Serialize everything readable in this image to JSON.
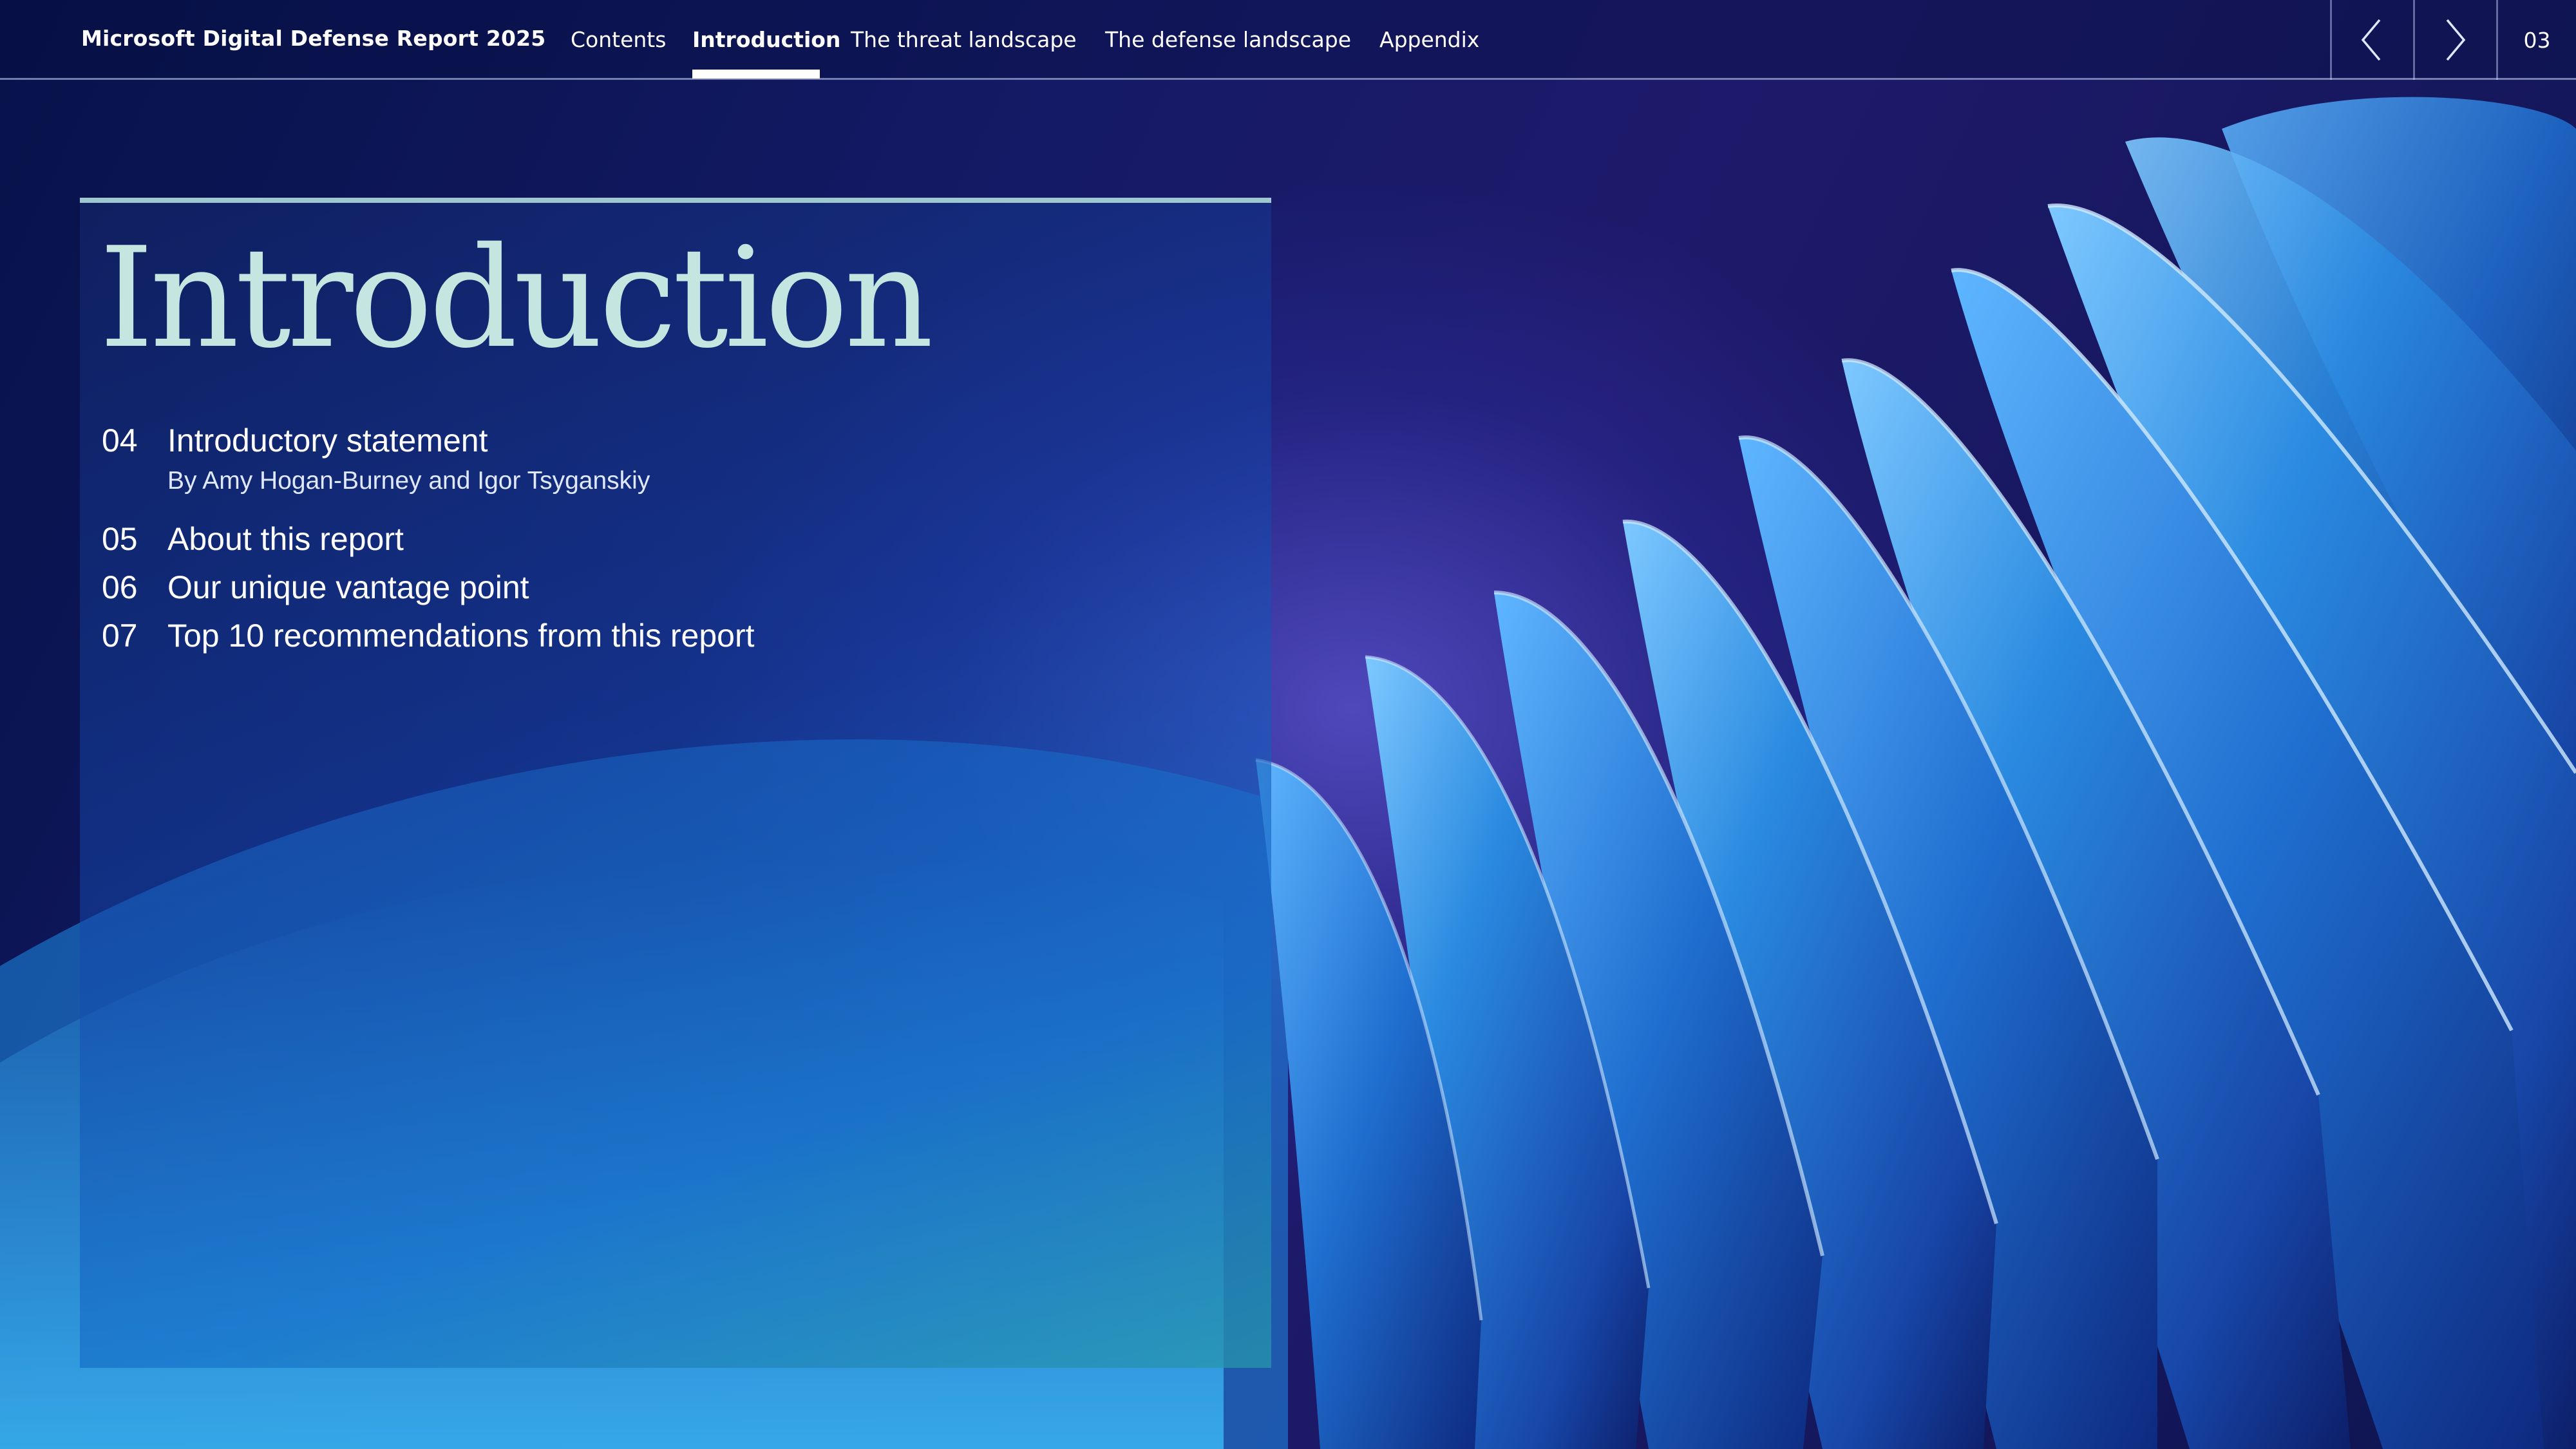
{
  "header": {
    "brand": "Microsoft Digital Defense Report 2025",
    "nav": [
      {
        "label": "Contents"
      },
      {
        "label": "Introduction"
      },
      {
        "label": "The threat landscape"
      },
      {
        "label": "The defense landscape"
      },
      {
        "label": "Appendix"
      }
    ],
    "active_tab": "Introduction",
    "prev_icon": "chevron-left-icon",
    "next_icon": "chevron-right-icon",
    "page_number": "03"
  },
  "panel": {
    "title": "Introduction",
    "toc": [
      {
        "page": "04",
        "label": "Introductory statement",
        "byline": "By Amy Hogan-Burney and Igor Tsyganskiy"
      },
      {
        "page": "05",
        "label": "About this report"
      },
      {
        "page": "06",
        "label": "Our unique vantage point"
      },
      {
        "page": "07",
        "label": "Top 10 recommendations from this report"
      }
    ]
  },
  "colors": {
    "background_dark": "#0d1452",
    "accent_title": "#c5e6e0",
    "panel_rule": "#9fc7cf",
    "fin_blue": "#2a8ae0"
  }
}
